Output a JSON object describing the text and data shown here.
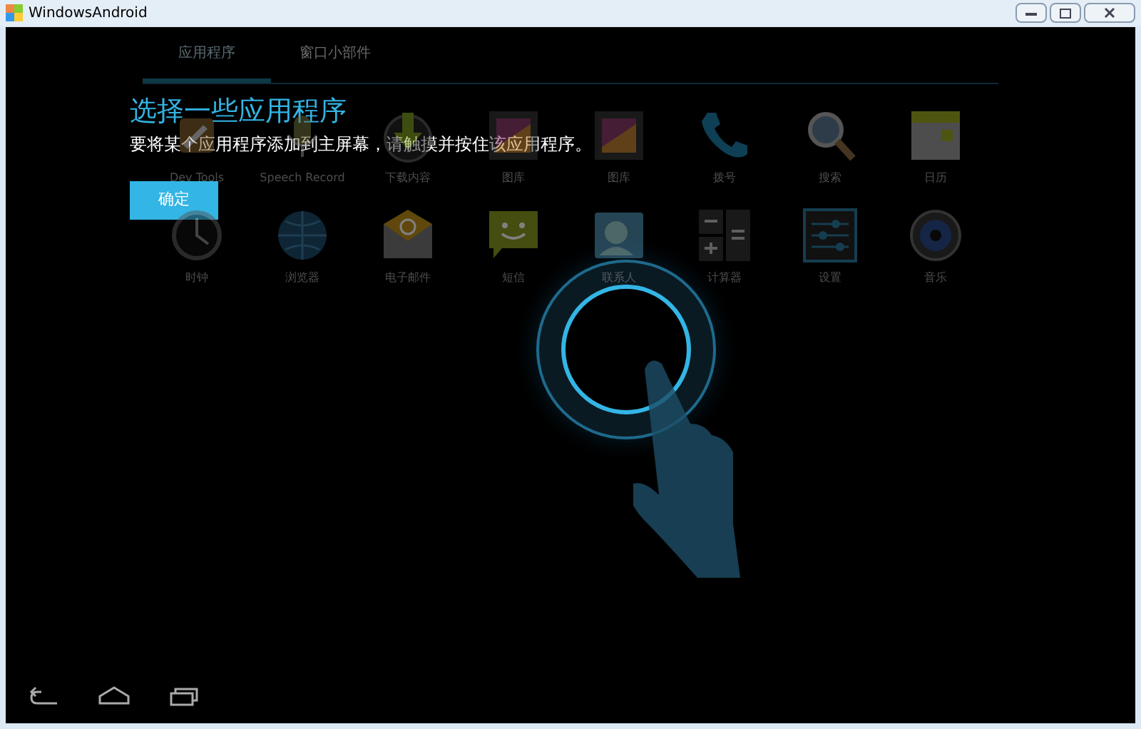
{
  "window": {
    "title": "WindowsAndroid"
  },
  "tabs": [
    {
      "label": "应用程序",
      "selected": true
    },
    {
      "label": "窗口小部件",
      "selected": false
    }
  ],
  "apps": [
    {
      "kind": "tools",
      "label": "Dev Tools"
    },
    {
      "kind": "mic",
      "label": "Speech Record"
    },
    {
      "kind": "download",
      "label": "下载内容"
    },
    {
      "kind": "gallery",
      "label": "图库"
    },
    {
      "kind": "gallery",
      "label": "图库"
    },
    {
      "kind": "phone",
      "label": "拨号"
    },
    {
      "kind": "search",
      "label": "搜索"
    },
    {
      "kind": "calendar",
      "label": "日历"
    },
    {
      "kind": "clock",
      "label": "时钟"
    },
    {
      "kind": "globe",
      "label": "浏览器"
    },
    {
      "kind": "email",
      "label": "电子邮件"
    },
    {
      "kind": "sms",
      "label": "短信"
    },
    {
      "kind": "contacts",
      "label": "联系人"
    },
    {
      "kind": "calculator",
      "label": "计算器"
    },
    {
      "kind": "settings",
      "label": "设置"
    },
    {
      "kind": "music",
      "label": "音乐"
    }
  ],
  "intro": {
    "title": "选择一些应用程序",
    "message": "要将某个应用程序添加到主屏幕，请触摸并按住该应用程序。",
    "button": "确定"
  }
}
